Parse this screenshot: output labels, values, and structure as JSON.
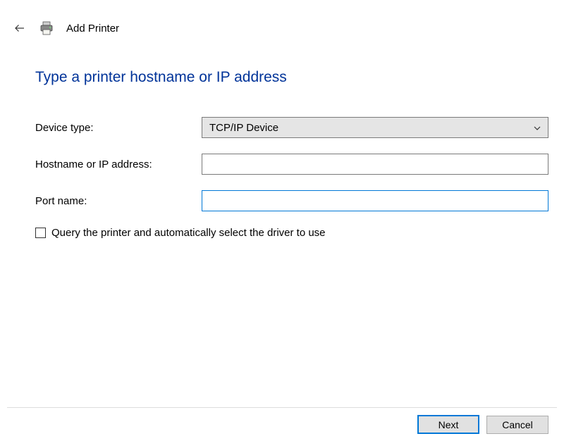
{
  "header": {
    "title": "Add Printer"
  },
  "page": {
    "title": "Type a printer hostname or IP address"
  },
  "form": {
    "device_type": {
      "label": "Device type:",
      "selected": "TCP/IP Device"
    },
    "hostname": {
      "label": "Hostname or IP address:",
      "value": ""
    },
    "port_name": {
      "label": "Port name:",
      "value": ""
    },
    "query_checkbox": {
      "label": "Query the printer and automatically select the driver to use",
      "checked": false
    }
  },
  "footer": {
    "next": "Next",
    "cancel": "Cancel"
  }
}
